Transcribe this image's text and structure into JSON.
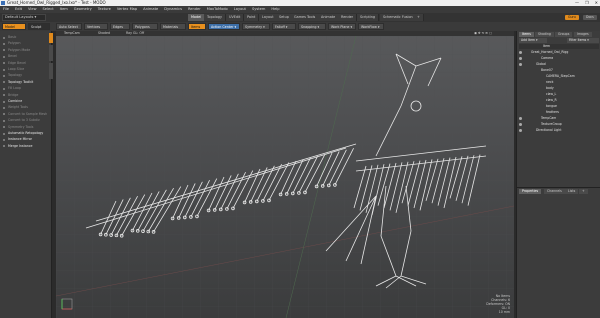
{
  "window": {
    "title": "Great_Horned_Owl_Rigged_lxo.lxo* - Test - MODO",
    "controls": [
      "—",
      "❐",
      "✕"
    ]
  },
  "menu": [
    "File",
    "Edit",
    "View",
    "Select",
    "Item",
    "Geometry",
    "Texture",
    "Vertex Map",
    "Animate",
    "Dynamics",
    "Render",
    "MaxToModo",
    "Layout",
    "System",
    "Help"
  ],
  "layout": {
    "selector": "Default Layouts ▾",
    "tabs": [
      "Model",
      "Topology",
      "UVEdit",
      "Paint",
      "Layout",
      "Setup",
      "Games Tools",
      "Animate",
      "Render",
      "Scripting",
      "Schematic Fusion",
      "+"
    ],
    "active_tab": "Model",
    "right": {
      "user": "Guru",
      "docs": "Docs"
    }
  },
  "toolbar": {
    "model_btn": "Model",
    "sculpt_btn": "Sculpt",
    "auto_select": "Auto Select",
    "vertices": "Vertices",
    "edges": "Edges",
    "polygons": "Polygons",
    "materials": "Materials",
    "items": "Items",
    "action_center": "Action Center ▾",
    "symmetry": "Symmetry ▾",
    "falloff": "Falloff ▾",
    "snapping": "Snapping ▾",
    "work_plane": "Work Plane ▾",
    "workflow": "WorkFlow ▾"
  },
  "left_panel": {
    "items": [
      {
        "label": "Basic",
        "bright": false
      },
      {
        "label": "Polygon",
        "bright": false
      },
      {
        "label": "Polygon Mode",
        "bright": false
      },
      {
        "label": "Bevel",
        "bright": false
      },
      {
        "label": "Edge Bevel",
        "bright": false
      },
      {
        "label": "Loop Slice",
        "bright": false
      },
      {
        "label": "Topology",
        "bright": false
      },
      {
        "label": "Topology Toolkit",
        "bright": true
      },
      {
        "label": "Fill Loop",
        "bright": false
      },
      {
        "label": "Bridge",
        "bright": false
      },
      {
        "label": "Combine",
        "bright": true
      },
      {
        "label": "Weight Tools",
        "bright": false
      },
      {
        "label": "Convert to Sample Mesh",
        "bright": false
      },
      {
        "label": "Convert to 3 Subdiv",
        "bright": false
      },
      {
        "label": "Symmetry Tools",
        "bright": false
      },
      {
        "label": "Automatic Retopology",
        "bright": true
      },
      {
        "label": "Instance Mirror",
        "bright": true
      },
      {
        "label": "Merge Instance",
        "bright": true
      }
    ]
  },
  "viewport": {
    "header": {
      "camera": "TempCam",
      "shading": "Shaded",
      "ray": "Ray GL: Off"
    },
    "info": [
      "No Items",
      "Channels: 6",
      "Deformers: ON",
      "GL: 0",
      "10 mm"
    ]
  },
  "right_panel": {
    "tabs": [
      "Items",
      "Shading",
      "Groups",
      "Images"
    ],
    "active_tab": "Items",
    "add_item": "Add Item ▾",
    "filter": "Filter Items ▾",
    "header": "Item",
    "tree": [
      {
        "label": "Great_Horned_Owl_Rigg",
        "indent": 0,
        "eye": true,
        "selected": false
      },
      {
        "label": "Camera",
        "indent": 2,
        "eye": true,
        "selected": false
      },
      {
        "label": "Global",
        "indent": 1,
        "eye": true,
        "selected": false
      },
      {
        "label": "Bone07",
        "indent": 2,
        "eye": false,
        "selected": false
      },
      {
        "label": "CAMERA_StepCam",
        "indent": 3,
        "eye": false,
        "selected": false
      },
      {
        "label": "neck",
        "indent": 3,
        "eye": false,
        "selected": false
      },
      {
        "label": "body",
        "indent": 3,
        "eye": false,
        "selected": false
      },
      {
        "label": "claw_L",
        "indent": 3,
        "eye": false,
        "selected": false
      },
      {
        "label": "claw_R",
        "indent": 3,
        "eye": false,
        "selected": false
      },
      {
        "label": "tongue",
        "indent": 3,
        "eye": false,
        "selected": false
      },
      {
        "label": "feathers",
        "indent": 3,
        "eye": false,
        "selected": false
      },
      {
        "label": "TempCam",
        "indent": 2,
        "eye": true,
        "selected": false
      },
      {
        "label": "TextureGroup",
        "indent": 2,
        "eye": true,
        "selected": false
      },
      {
        "label": "Directional Light",
        "indent": 1,
        "eye": true,
        "selected": false
      }
    ],
    "bottom_tabs": [
      "Properties",
      "Channels",
      "Lists",
      "+"
    ]
  },
  "colors": {
    "accent": "#e08a1c",
    "viewport_top": "#58595b",
    "viewport_bottom": "#3b3c3d",
    "selection_blue": "#3d6fa8"
  }
}
